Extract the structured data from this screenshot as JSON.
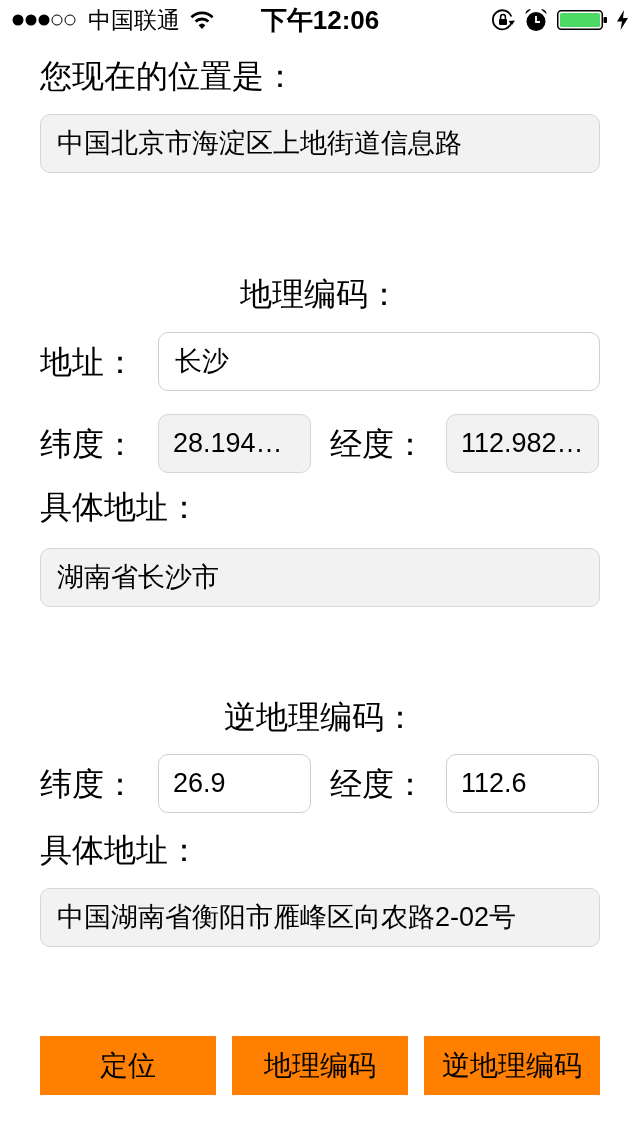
{
  "status_bar": {
    "carrier": "中国联通",
    "time": "下午12:06"
  },
  "current_location": {
    "label": "您现在的位置是：",
    "field": {
      "value": "中国北京市海淀区上地街道信息路",
      "editable": false
    }
  },
  "geocode": {
    "heading": "地理编码：",
    "address": {
      "label": "地址：",
      "value": "长沙",
      "editable": true
    },
    "latitude": {
      "label": "纬度：",
      "value": "28.194…",
      "editable": false
    },
    "longitude": {
      "label": "经度：",
      "value": "112.982…",
      "editable": false
    },
    "detail": {
      "label": "具体地址：",
      "value": "湖南省长沙市",
      "editable": false
    }
  },
  "reverse_geocode": {
    "heading": "逆地理编码：",
    "latitude": {
      "label": "纬度：",
      "value": "26.9",
      "editable": true
    },
    "longitude": {
      "label": "经度：",
      "value": "112.6",
      "editable": true
    },
    "detail": {
      "label": "具体地址：",
      "value": "中国湖南省衡阳市雁峰区向农路2-02号",
      "editable": false
    }
  },
  "buttons": [
    {
      "label": "定位"
    },
    {
      "label": "地理编码"
    },
    {
      "label": "逆地理编码"
    }
  ]
}
